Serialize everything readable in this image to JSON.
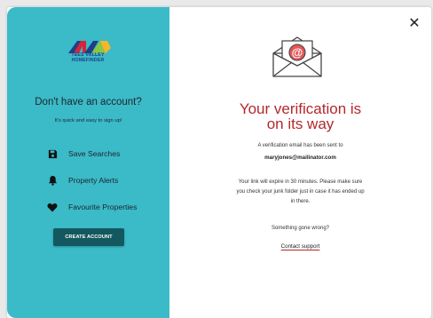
{
  "brand": {
    "logo_text_line1": "TEES VALLEY",
    "logo_text_line2": "HOMEFINDER",
    "colors": {
      "navy": "#1e3f87",
      "red": "#d6243b",
      "green": "#8dc63f",
      "yellow": "#f7b52c"
    }
  },
  "signup": {
    "title": "Don't have an account?",
    "subtitle": "It's quick and easy to sign up!",
    "features": [
      {
        "icon": "floppy-disk-icon",
        "label": "Save Searches"
      },
      {
        "icon": "bell-icon",
        "label": "Property Alerts"
      },
      {
        "icon": "heart-icon",
        "label": "Favourite Properties"
      }
    ],
    "button_label": "CREATE ACCOUNT",
    "panel_color": "#3bbac7",
    "button_color": "#14585f"
  },
  "dialog": {
    "close_icon": "close-icon",
    "envelope_icon": "email-envelope-icon",
    "title": "Your verification is on its way",
    "title_color": "#b3282d",
    "sent_text": "A verification email has been sent to",
    "email": "maryjones@mailinator.com",
    "expiry_line1": "Your link will expire in 30 minutes. Please make sure",
    "expiry_line2": "you check your junk folder just in case it has ended up",
    "expiry_line3": "in there.",
    "wrong_text": "Something gone wrong?",
    "support_link": "Contact support"
  }
}
